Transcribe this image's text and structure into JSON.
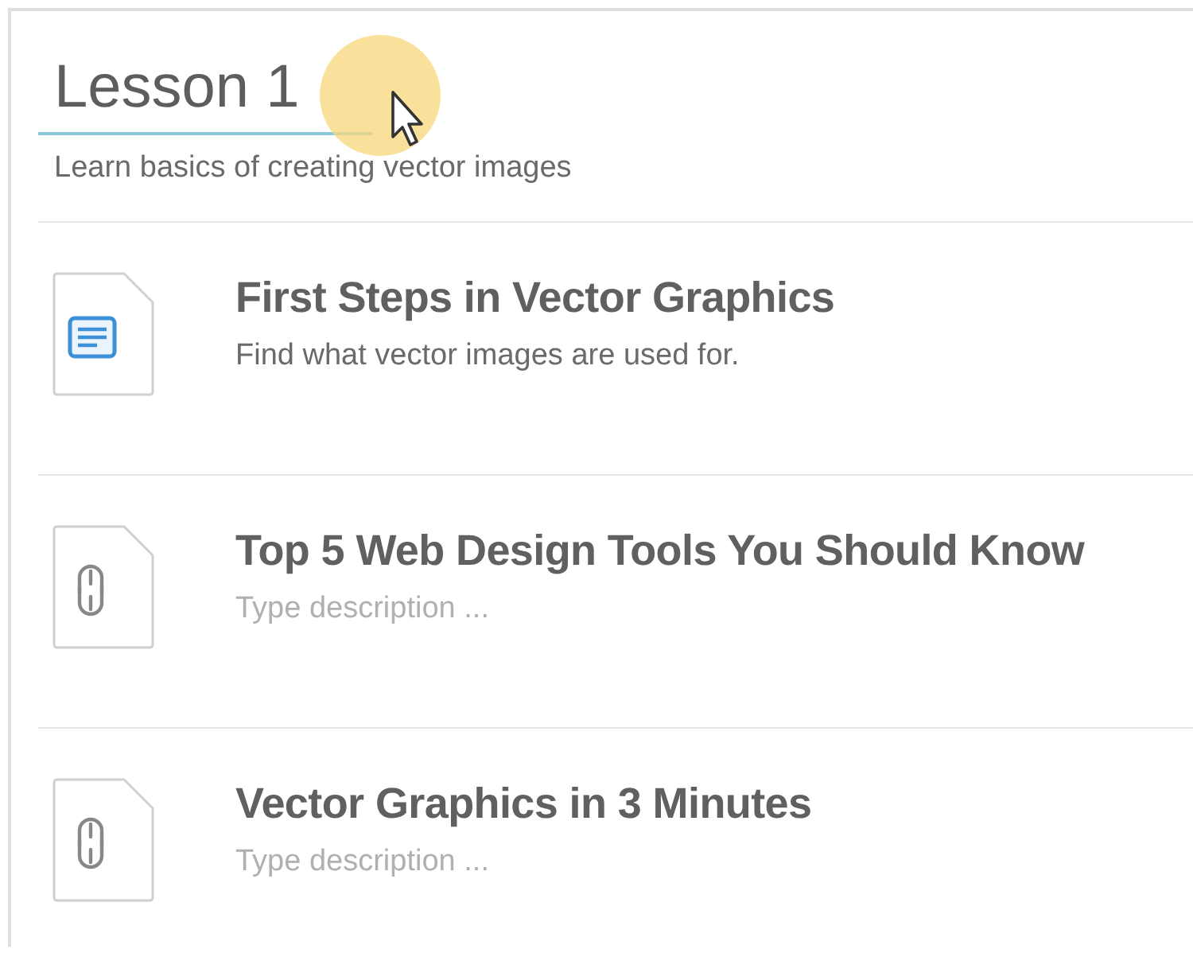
{
  "lesson": {
    "title": "Lesson 1",
    "subtitle": "Learn basics of creating vector images"
  },
  "items": [
    {
      "kind": "document",
      "title": "First Steps in Vector Graphics",
      "description": {
        "value": "Find what vector images are used for."
      }
    },
    {
      "kind": "link",
      "title": "Top 5 Web Design Tools You Should Know",
      "description": {
        "placeholder": "Type description ..."
      }
    },
    {
      "kind": "link",
      "title": "Vector Graphics in 3 Minutes",
      "description": {
        "placeholder": "Type description ..."
      }
    }
  ]
}
